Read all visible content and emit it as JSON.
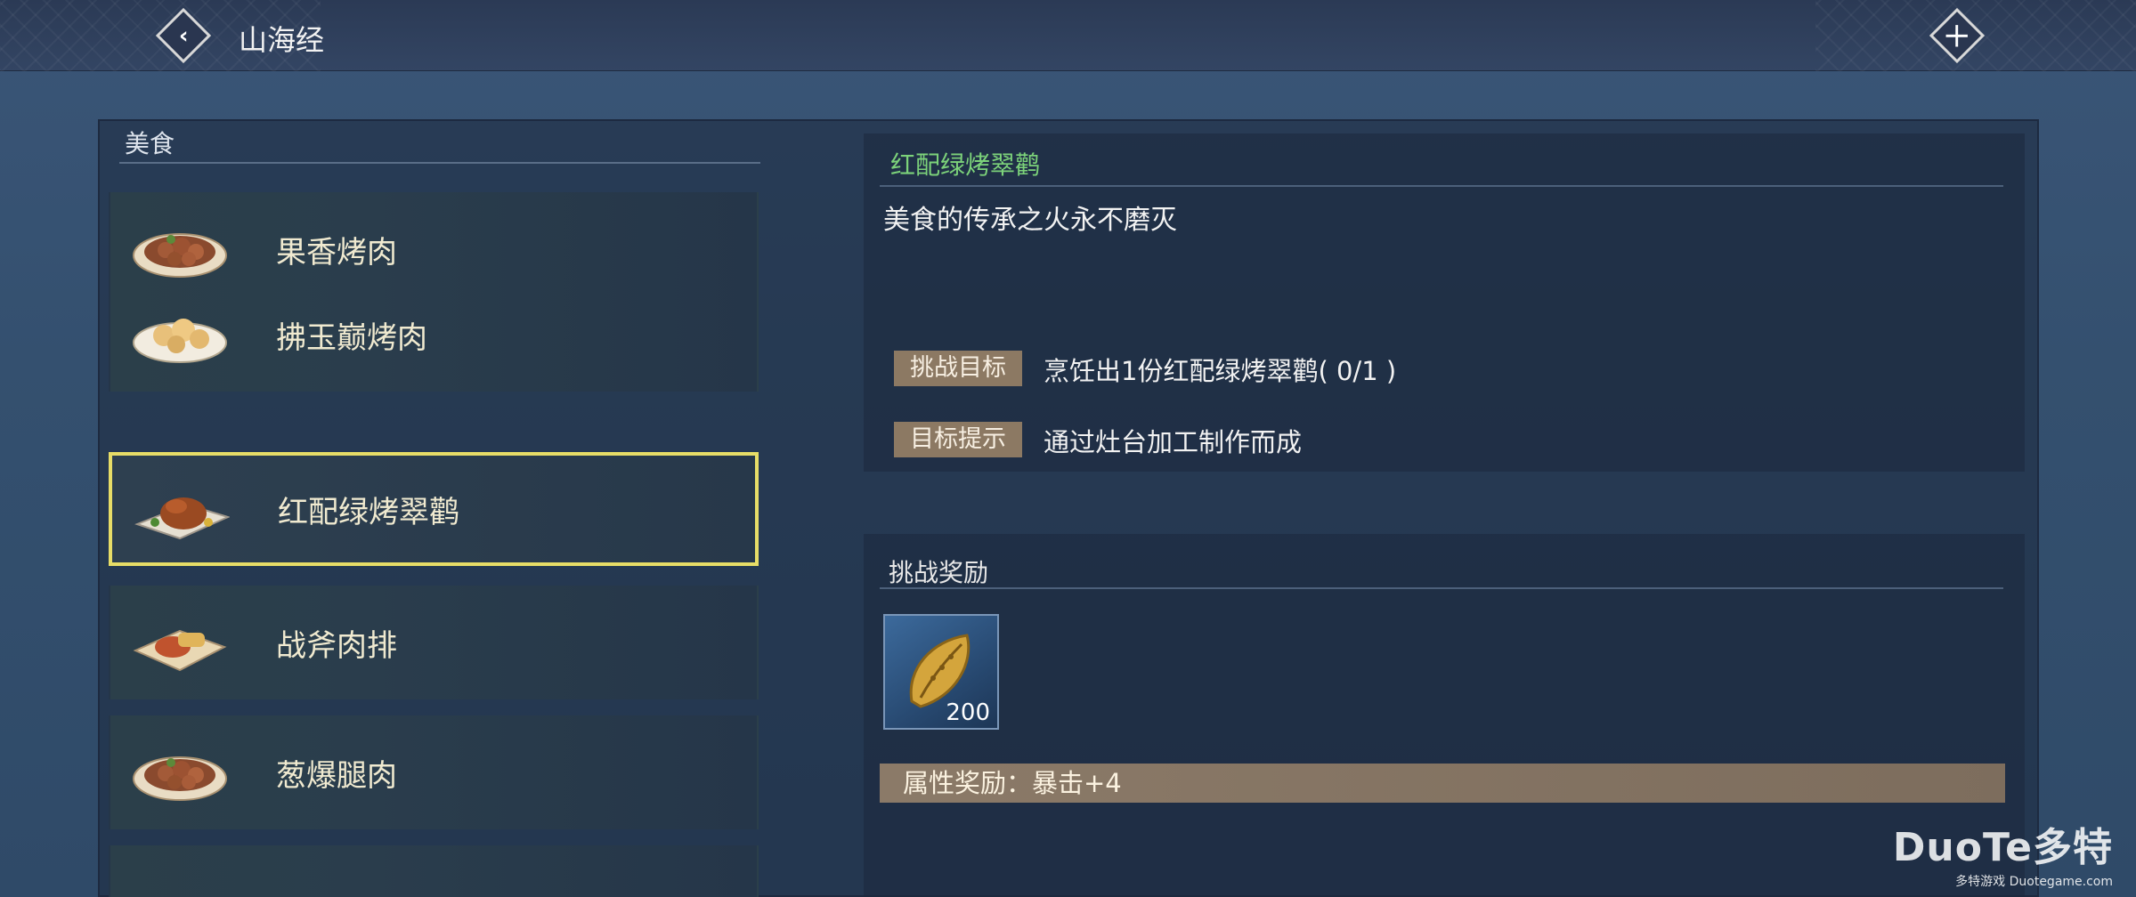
{
  "header": {
    "title": "山海经",
    "back_icon": "chevron-left-icon",
    "close_icon": "close-icon"
  },
  "category": {
    "title": "美食"
  },
  "food_list": [
    {
      "label": "果香烤肉",
      "icon": "roast-meat-plate-icon",
      "selected": false
    },
    {
      "label": "拂玉巅烤肉",
      "icon": "bun-plate-icon",
      "selected": false
    },
    {
      "label": "红配绿烤翠鹳",
      "icon": "roast-bird-plate-icon",
      "selected": true
    },
    {
      "label": "战斧肉排",
      "icon": "steak-plate-icon",
      "selected": false
    },
    {
      "label": "葱爆腿肉",
      "icon": "roast-meat-plate-icon",
      "selected": false
    }
  ],
  "detail": {
    "title": "红配绿烤翠鹳",
    "description": "美食的传承之火永不磨灭",
    "goal_tag": "挑战目标",
    "goal_text": "烹饪出1份红配绿烤翠鹳( 0/1 )",
    "hint_tag": "目标提示",
    "hint_text": "通过灶台加工制作而成"
  },
  "reward": {
    "title": "挑战奖励",
    "item_icon": "seed-item-icon",
    "item_count": "200",
    "attr_text": "属性奖励：暴击+4"
  },
  "watermark": {
    "brand": "DuoTe多特",
    "sub": "多特游戏 Duotegame.com"
  },
  "colors": {
    "accent_green": "#7cd27a",
    "selection_border": "#e7dd67",
    "tag_bg": "#8c7963"
  }
}
